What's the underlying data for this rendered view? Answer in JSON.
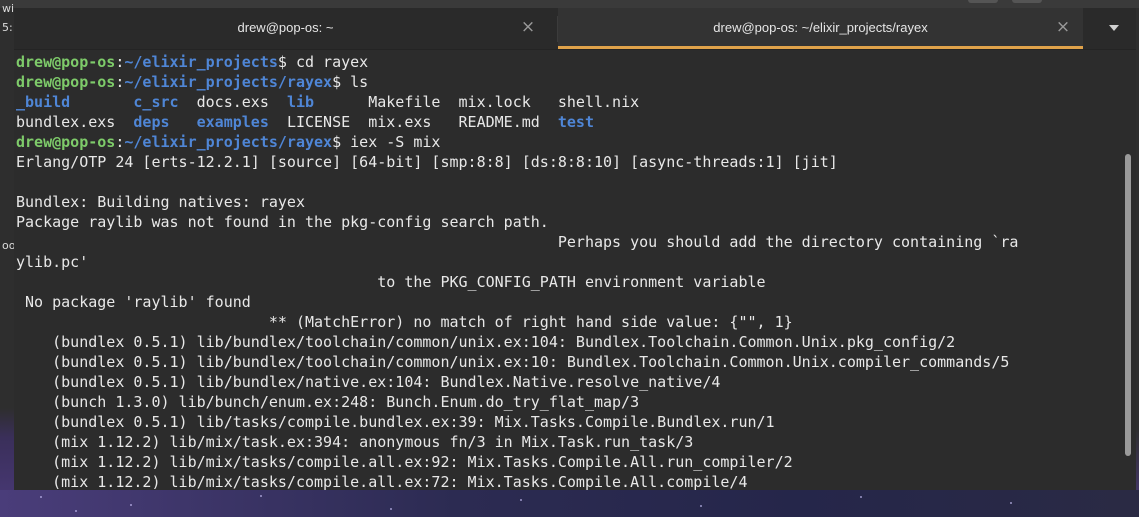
{
  "background": {
    "left_labels": [
      "wi",
      "5:",
      "oo"
    ]
  },
  "tabs": [
    {
      "title": "drew@pop-os: ~",
      "active": false
    },
    {
      "title": "drew@pop-os: ~/elixir_projects/rayex",
      "active": true
    }
  ],
  "colors": {
    "accent": "#e0a24a",
    "user": "#7ecb6a",
    "path": "#4f86d6",
    "text": "#e8e8e8",
    "terminal_bg": "#2c2c2c"
  },
  "terminal": {
    "prompt1": {
      "user": "drew@pop-os",
      "sep": ":",
      "path": "~/elixir_projects",
      "sym": "$",
      "cmd": " cd rayex"
    },
    "prompt2": {
      "user": "drew@pop-os",
      "sep": ":",
      "path": "~/elixir_projects/rayex",
      "sym": "$",
      "cmd": " ls"
    },
    "ls": {
      "row1": [
        "_build",
        "c_src",
        "docs.exs",
        "lib",
        "Makefile",
        "mix.lock",
        "shell.nix"
      ],
      "row2": [
        "bundlex.exs",
        "deps",
        "examples",
        "LICENSE",
        "mix.exs",
        "README.md",
        "test"
      ]
    },
    "prompt3": {
      "user": "drew@pop-os",
      "sep": ":",
      "path": "~/elixir_projects/rayex",
      "sym": "$",
      "cmd": " iex -S mix"
    },
    "output": [
      "Erlang/OTP 24 [erts-12.2.1] [source] [64-bit] [smp:8:8] [ds:8:8:10] [async-threads:1] [jit]",
      "",
      "Bundlex: Building natives: rayex",
      "Package raylib was not found in the pkg-config search path.",
      "                                                            Perhaps you should add the directory containing `ra",
      "ylib.pc'",
      "                                        to the PKG_CONFIG_PATH environment variable",
      " No package 'raylib' found",
      "                            ** (MatchError) no match of right hand side value: {\"\", 1}",
      "    (bundlex 0.5.1) lib/bundlex/toolchain/common/unix.ex:104: Bundlex.Toolchain.Common.Unix.pkg_config/2",
      "    (bundlex 0.5.1) lib/bundlex/toolchain/common/unix.ex:10: Bundlex.Toolchain.Common.Unix.compiler_commands/5",
      "    (bundlex 0.5.1) lib/bundlex/native.ex:104: Bundlex.Native.resolve_native/4",
      "    (bunch 1.3.0) lib/bunch/enum.ex:248: Bunch.Enum.do_try_flat_map/3",
      "    (bundlex 0.5.1) lib/tasks/compile.bundlex.ex:39: Mix.Tasks.Compile.Bundlex.run/1",
      "    (mix 1.12.2) lib/mix/task.ex:394: anonymous fn/3 in Mix.Task.run_task/3",
      "    (mix 1.12.2) lib/mix/tasks/compile.all.ex:92: Mix.Tasks.Compile.All.run_compiler/2",
      "    (mix 1.12.2) lib/mix/tasks/compile.all.ex:72: Mix.Tasks.Compile.All.compile/4"
    ]
  }
}
